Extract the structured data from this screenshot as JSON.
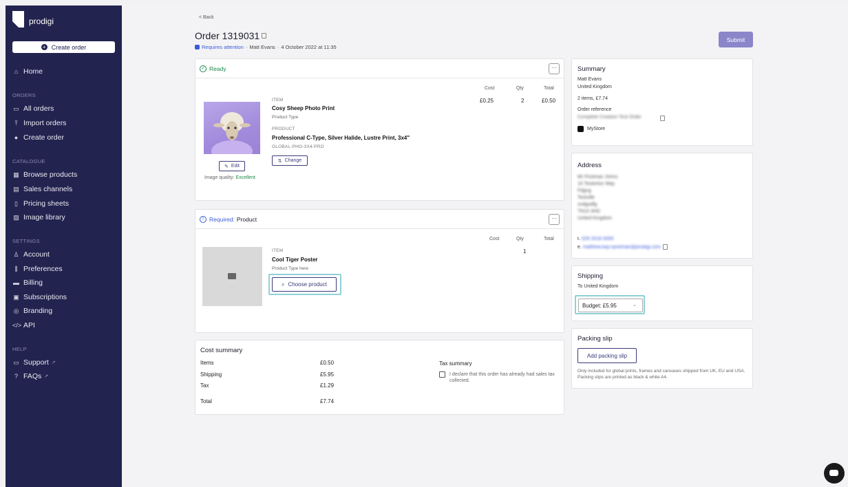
{
  "sidebar": {
    "logo_text": "prodigi",
    "create_order_button": "Create order",
    "home": "Home",
    "sections": {
      "orders": "ORDERS",
      "catalogue": "CATALOGUE",
      "settings": "SETTINGS",
      "help": "HELP"
    },
    "orders_items": [
      "All orders",
      "Import orders",
      "Create order"
    ],
    "catalogue_items": [
      "Browse products",
      "Sales channels",
      "Pricing sheets",
      "Image library"
    ],
    "settings_items": [
      "Account",
      "Preferences",
      "Billing",
      "Subscriptions",
      "Branding",
      "API"
    ],
    "help_items": [
      "Support",
      "FAQs"
    ]
  },
  "header": {
    "back": "< Back",
    "title": "Order 1319031",
    "status": "Requires attention",
    "customer": "Matt Evans",
    "date": "4 October 2022 at 11:35",
    "submit": "Submit"
  },
  "item1": {
    "status": "Ready",
    "more": "···",
    "cols": {
      "cost": "Cost",
      "qty": "Qty",
      "total": "Total"
    },
    "item_label": "ITEM",
    "name": "Cosy Sheep Photo Print",
    "product_type": "Product Type",
    "product_label": "PRODUCT",
    "product_name": "Professional C-Type, Silver Halide, Lustre Print, 3x4\"",
    "sku": "GLOBAL-PHO-3X4-PRO",
    "change": "Change",
    "edit": "Edit",
    "quality_label": "Image quality:",
    "quality_value": "Excellent",
    "cost": "£0.25",
    "qty": "2",
    "total": "£0.50"
  },
  "item2": {
    "status_required": "Required:",
    "status_product": "Product",
    "more": "···",
    "cols": {
      "cost": "Cost",
      "qty": "Qty",
      "total": "Total"
    },
    "item_label": "ITEM",
    "name": "Cool Tiger Poster",
    "product_type": "Product Type here",
    "choose": "Choose product",
    "qty": "1"
  },
  "cost_summary": {
    "title": "Cost summary",
    "items_label": "Items",
    "items_value": "£0.50",
    "shipping_label": "Shipping",
    "shipping_value": "£5.95",
    "tax_label": "Tax",
    "tax_value": "£1.29",
    "total_label": "Total",
    "total_value": "£7.74",
    "tax_summary_title": "Tax summary",
    "tax_declare": "I declare that this order has already had sales tax collected."
  },
  "summary": {
    "title": "Summary",
    "name": "Matt Evans",
    "country": "United Kingdom",
    "items_total": "2 items, £7.74",
    "order_ref_label": "Order reference",
    "order_ref_value": "Complete Creation Test Order",
    "store": "MyStore"
  },
  "address": {
    "title": "Address",
    "lines": [
      "Mr Postman Johns",
      "15 Testerton Way",
      "Fdgng",
      "Testville",
      "sndgsdfg",
      "TN10 3HD",
      "United Kingdom"
    ],
    "phone_label": "t.",
    "phone": "029 2018 0000",
    "email_label": "e.",
    "email": "matthew.kay+postman@prodigi.com"
  },
  "shipping": {
    "title": "Shipping",
    "to": "To United Kingdom",
    "selected": "Budget: £5.95"
  },
  "packing": {
    "title": "Packing slip",
    "button": "Add packing slip",
    "note": "Only included for global prints, frames and canvases shipped from UK, EU and USA. Packing slips are printed as black & white A4."
  },
  "colors": {
    "sidebar": "#23234f",
    "accent": "#3a5bd9",
    "success": "#1a8a4a",
    "submit": "#8a86c9",
    "highlight": "#8fd1d8"
  }
}
